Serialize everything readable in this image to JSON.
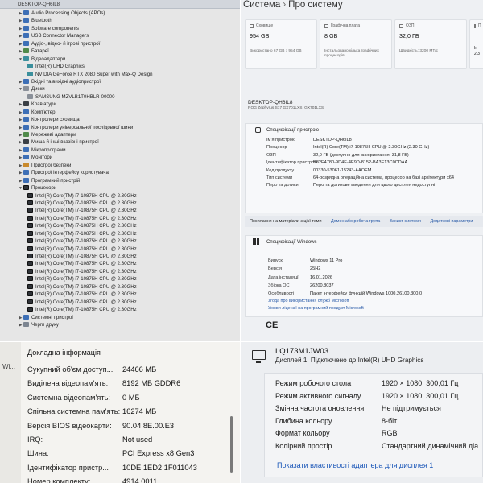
{
  "device_manager": {
    "computer_name": "DESKTOP-QH6IL8",
    "items": [
      {
        "label": "Audio Processing Objects (APOs)",
        "level": 0,
        "twisty": "▶",
        "icon": "speaker-icon"
      },
      {
        "label": "Bluetooth",
        "level": 0,
        "twisty": "▶",
        "icon": "bluetooth-icon"
      },
      {
        "label": "Software components",
        "level": 0,
        "twisty": "▶",
        "icon": "puzzle-icon"
      },
      {
        "label": "USB Connector Managers",
        "level": 0,
        "twisty": "▶",
        "icon": "usb-icon"
      },
      {
        "label": "Аудіо-, відео- й ігрові пристрої",
        "level": 0,
        "twisty": "▶",
        "icon": "speaker-icon"
      },
      {
        "label": "Батареї",
        "level": 0,
        "twisty": "▶",
        "icon": "battery-icon"
      },
      {
        "label": "Відеоадаптери",
        "level": 0,
        "twisty": "▼",
        "icon": "display-adapter-icon"
      },
      {
        "label": "Intel(R) UHD Graphics",
        "level": 1,
        "twisty": "",
        "icon": "display-adapter-icon"
      },
      {
        "label": "NVIDIA GeForce RTX 2080 Super with Max-Q Design",
        "level": 1,
        "twisty": "",
        "icon": "display-adapter-icon"
      },
      {
        "label": "Вхідні та вихідні аудіопристрої",
        "level": 0,
        "twisty": "▶",
        "icon": "speaker-icon"
      },
      {
        "label": "Диски",
        "level": 0,
        "twisty": "▼",
        "icon": "disk-icon"
      },
      {
        "label": "SAMSUNG MZVLB1T0HBLR-00000",
        "level": 1,
        "twisty": "",
        "icon": "disk-icon"
      },
      {
        "label": "Клавіатури",
        "level": 0,
        "twisty": "▶",
        "icon": "keyboard-icon"
      },
      {
        "label": "Комп'ютер",
        "level": 0,
        "twisty": "▶",
        "icon": "computer-icon"
      },
      {
        "label": "Контролери сховища",
        "level": 0,
        "twisty": "▶",
        "icon": "storage-icon"
      },
      {
        "label": "Контролери універсальної послідовної шини",
        "level": 0,
        "twisty": "▶",
        "icon": "usb-icon"
      },
      {
        "label": "Мережеві адаптери",
        "level": 0,
        "twisty": "▶",
        "icon": "network-icon"
      },
      {
        "label": "Миша й інші вказівні пристрої",
        "level": 0,
        "twisty": "▶",
        "icon": "mouse-icon"
      },
      {
        "label": "Мікропрограми",
        "level": 0,
        "twisty": "▶",
        "icon": "firmware-icon"
      },
      {
        "label": "Монітори",
        "level": 0,
        "twisty": "▶",
        "icon": "monitor-icon"
      },
      {
        "label": "Пристрої безпеки",
        "level": 0,
        "twisty": "▶",
        "icon": "security-icon"
      },
      {
        "label": "Пристрої інтерфейсу користувача",
        "level": 0,
        "twisty": "▶",
        "icon": "hid-icon"
      },
      {
        "label": "Програмний пристрій",
        "level": 0,
        "twisty": "▶",
        "icon": "software-device-icon"
      },
      {
        "label": "Процесори",
        "level": 0,
        "twisty": "▼",
        "icon": "cpu-icon"
      },
      {
        "label": "Intel(R) Core(TM) i7-10875H CPU @ 2.30GHz",
        "level": 1,
        "twisty": "",
        "icon": "cpu-icon"
      },
      {
        "label": "Intel(R) Core(TM) i7-10875H CPU @ 2.30GHz",
        "level": 1,
        "twisty": "",
        "icon": "cpu-icon"
      },
      {
        "label": "Intel(R) Core(TM) i7-10875H CPU @ 2.30GHz",
        "level": 1,
        "twisty": "",
        "icon": "cpu-icon"
      },
      {
        "label": "Intel(R) Core(TM) i7-10875H CPU @ 2.30GHz",
        "level": 1,
        "twisty": "",
        "icon": "cpu-icon"
      },
      {
        "label": "Intel(R) Core(TM) i7-10875H CPU @ 2.30GHz",
        "level": 1,
        "twisty": "",
        "icon": "cpu-icon"
      },
      {
        "label": "Intel(R) Core(TM) i7-10875H CPU @ 2.30GHz",
        "level": 1,
        "twisty": "",
        "icon": "cpu-icon"
      },
      {
        "label": "Intel(R) Core(TM) i7-10875H CPU @ 2.30GHz",
        "level": 1,
        "twisty": "",
        "icon": "cpu-icon"
      },
      {
        "label": "Intel(R) Core(TM) i7-10875H CPU @ 2.30GHz",
        "level": 1,
        "twisty": "",
        "icon": "cpu-icon"
      },
      {
        "label": "Intel(R) Core(TM) i7-10875H CPU @ 2.30GHz",
        "level": 1,
        "twisty": "",
        "icon": "cpu-icon"
      },
      {
        "label": "Intel(R) Core(TM) i7-10875H CPU @ 2.30GHz",
        "level": 1,
        "twisty": "",
        "icon": "cpu-icon"
      },
      {
        "label": "Intel(R) Core(TM) i7-10875H CPU @ 2.30GHz",
        "level": 1,
        "twisty": "",
        "icon": "cpu-icon"
      },
      {
        "label": "Intel(R) Core(TM) i7-10875H CPU @ 2.30GHz",
        "level": 1,
        "twisty": "",
        "icon": "cpu-icon"
      },
      {
        "label": "Intel(R) Core(TM) i7-10875H CPU @ 2.30GHz",
        "level": 1,
        "twisty": "",
        "icon": "cpu-icon"
      },
      {
        "label": "Intel(R) Core(TM) i7-10875H CPU @ 2.30GHz",
        "level": 1,
        "twisty": "",
        "icon": "cpu-icon"
      },
      {
        "label": "Intel(R) Core(TM) i7-10875H CPU @ 2.30GHz",
        "level": 1,
        "twisty": "",
        "icon": "cpu-icon"
      },
      {
        "label": "Intel(R) Core(TM) i7-10875H CPU @ 2.30GHz",
        "level": 1,
        "twisty": "",
        "icon": "cpu-icon"
      },
      {
        "label": "Системні пристрої",
        "level": 0,
        "twisty": "▶",
        "icon": "system-device-icon"
      },
      {
        "label": "Черги друку",
        "level": 0,
        "twisty": "▶",
        "icon": "printer-icon"
      }
    ]
  },
  "settings": {
    "breadcrumb_parent": "Система",
    "breadcrumb_sep": "›",
    "breadcrumb_current": "Про систему",
    "cards": [
      {
        "label": "Сховище",
        "value": "954 GB",
        "detail": "Використано 67 GB з 954 GB"
      },
      {
        "label": "Графічна плата",
        "value": "8 GB",
        "detail": "Інстальовано кілька графічних процесорів"
      },
      {
        "label": "ОЗП",
        "value": "32,0 ГБ",
        "detail": "Швидкість: 3200 МТ/с"
      },
      {
        "label": "П",
        "value": "",
        "detail": ""
      }
    ],
    "card4_partial": [
      "In",
      "2.3"
    ],
    "device_name": "DESKTOP-QH6IL8",
    "device_model": "ROG Zephyrus S17 GX701LXS_GX701LXS",
    "device_specs_title": "Специфікації пристрою",
    "device_specs": [
      {
        "k": "Ім'я пристрою",
        "v": "DESKTOP-QH6IL8"
      },
      {
        "k": "Процесор",
        "v": "Intel(R) Core(TM) i7-10875H CPU @ 2.30GHz (2.30 GHz)"
      },
      {
        "k": "ОЗП",
        "v": "32,0 ГБ (доступно для використання: 31,8 ГБ)"
      },
      {
        "k": "Ідентифікатор пристрою",
        "v": "B82E4780-9D4E-4E9D-8152-BA3E13C0CDAA"
      },
      {
        "k": "Код продукту",
        "v": "00330-53061-15243-AAOEM"
      },
      {
        "k": "Тип системи",
        "v": "64-розрядна операційна система, процесор на базі архітектури x64"
      },
      {
        "k": "Перо та дотики",
        "v": "Перо та дотикове введення для цього дисплея недоступні"
      }
    ],
    "related_links": [
      "Посилання на матеріали з цієї теми",
      "Домен або робоча група",
      "Захист системи",
      "Додаткові параметри"
    ],
    "windows_specs_title": "Специфікації Windows",
    "windows_specs": [
      {
        "k": "Випуск",
        "v": "Windows 11 Pro"
      },
      {
        "k": "Версія",
        "v": "25H2"
      },
      {
        "k": "Дата інсталяції",
        "v": "16.01.2026"
      },
      {
        "k": "Збірка ОС",
        "v": "26200.8037"
      },
      {
        "k": "Особливості",
        "v": "Пакет інтерфейсу функцій Windows 1000.26100.300.0"
      }
    ],
    "windows_links": [
      "Угода про використання служб Microsoft",
      "Умови ліцензії на програмний продукт Microsoft"
    ],
    "ce_mark": "CE"
  },
  "adapter": {
    "side_label": "Wi...",
    "title": "Докладна інформація",
    "rows": [
      {
        "k": "Сукупний об'єм доступ...",
        "v": "24466 МБ"
      },
      {
        "k": "Виділена відеопам'ять:",
        "v": "8192 МБ GDDR6"
      },
      {
        "k": "Системна відеопам'ять:",
        "v": "0 МБ"
      },
      {
        "k": "Спільна системна пам'ять:",
        "v": "16274 МБ"
      },
      {
        "k": "Версія BIOS відеокарти:",
        "v": "90.04.8E.00.E3"
      },
      {
        "k": "IRQ:",
        "v": "Not used"
      },
      {
        "k": "Шина:",
        "v": "PCI Express x8 Gen3"
      },
      {
        "k": "Ідентифікатор пристр...",
        "v": "10DE 1ED2 1F011043"
      },
      {
        "k": "Номер комплекту:",
        "v": "4914 0011"
      }
    ]
  },
  "display": {
    "monitor_name": "LQ173M1JW03",
    "subtitle": "Дисплей 1: Підключено до Intel(R) UHD Graphics",
    "rows": [
      {
        "k": "Режим робочого стола",
        "v": "1920 × 1080, 300,01 Гц"
      },
      {
        "k": "Режим активного сигналу",
        "v": "1920 × 1080, 300,01 Гц"
      },
      {
        "k": "Змінна частота оновлення",
        "v": "Не підтримується"
      },
      {
        "k": "Глибина кольору",
        "v": "8-біт"
      },
      {
        "k": "Формат кольору",
        "v": "RGB"
      },
      {
        "k": "Колірний простір",
        "v": "Стандартний динамічний діа"
      }
    ],
    "adapter_link": "Показати властивості адаптера для дисплея 1"
  }
}
